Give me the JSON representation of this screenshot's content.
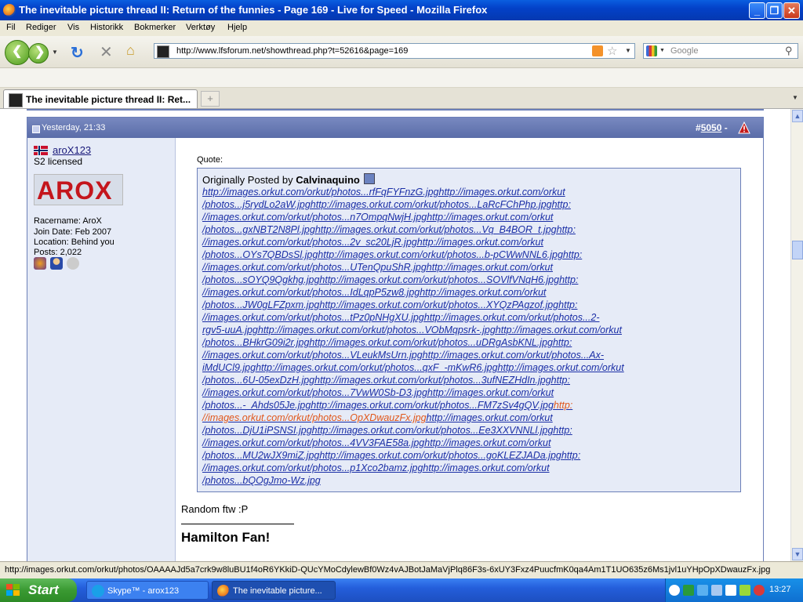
{
  "window": {
    "title": "The inevitable picture thread II: Return of the funnies - Page 169 - Live for Speed - Mozilla Firefox"
  },
  "menu": [
    "Fil",
    "Rediger",
    "Vis",
    "Historikk",
    "Bokmerker",
    "Verktøy",
    "Hjelp"
  ],
  "nav": {
    "url": "http://www.lfsforum.net/showthread.php?t=52616&page=169",
    "search_placeholder": "Google"
  },
  "tab": {
    "label": "The inevitable picture thread II: Ret..."
  },
  "post": {
    "date": "Yesterday, 21:33",
    "number_prefix": "#",
    "number": "5050",
    "number_suffix": "-",
    "user": {
      "name": "aroX123",
      "title": "S2 licensed",
      "avatar_text": "AROX",
      "racername": "Racername: AroX",
      "join_date": "Join Date: Feb 2007",
      "location": "Location: Behind you",
      "posts": "Posts: 2,022"
    },
    "quote_label": "Quote:",
    "quote_by_prefix": "Originally Posted by",
    "quote_author": "Calvinaquino",
    "quote_lines": [
      "http://images.orkut.com/orkut/photos...rfFqFYFnzG.jpghttp://images.orkut.com/orkut",
      "/photos...j5rydLo2aW.jpghttp://images.orkut.com/orkut/photos...LaRcFChPhp.jpghttp:",
      "//images.orkut.com/orkut/photos...n7OmpqNwjH.jpghttp://images.orkut.com/orkut",
      "/photos...gxNBT2N8Pl.jpghttp://images.orkut.com/orkut/photos...Vq_B4BOR_t.jpghttp:",
      "//images.orkut.com/orkut/photos...2v_sc20LjR.jpghttp://images.orkut.com/orkut",
      "/photos...OYs7QBDsSl.jpghttp://images.orkut.com/orkut/photos...b-pCWwNNL6.jpghttp:",
      "//images.orkut.com/orkut/photos...UTenQpuShR.jpghttp://images.orkut.com/orkut",
      "/photos...sOYQ9Qgkhg.jpghttp://images.orkut.com/orkut/photos...SOVlfVNqH6.jpghttp:",
      "//images.orkut.com/orkut/photos...IdLqpP5zw8.jpghttp://images.orkut.com/orkut",
      "/photos...JW0gLFZpxm.jpghttp://images.orkut.com/orkut/photos...XYQzPAgzof.jpghttp:",
      "//images.orkut.com/orkut/photos...tPz0pNHgXU.jpghttp://images.orkut.com/orkut/photos...2-",
      "rgv5-uuA.jpghttp://images.orkut.com/orkut/photos...VObMqpsrk-.jpghttp://images.orkut.com/orkut",
      "/photos...BHkrG09i2r.jpghttp://images.orkut.com/orkut/photos...uDRgAsbKNL.jpghttp:",
      "//images.orkut.com/orkut/photos...VLeukMsUrn.jpghttp://images.orkut.com/orkut/photos...Ax-",
      "iMdUCl9.jpghttp://images.orkut.com/orkut/photos...qxF_-mKwR6.jpghttp://images.orkut.com/orkut",
      "/photos...6U-05exDzH.jpghttp://images.orkut.com/orkut/photos...3ufNEZHdIn.jpghttp:",
      "//images.orkut.com/orkut/photos...7VwW0Sb-D3.jpghttp://images.orkut.com/orkut",
      "/photos...-_Ahds05Je.jpghttp://images.orkut.com/orkut/photos...FM7zSv4gQV.jpg",
      "//images.orkut.com/orkut/photos...OpXDwauzFx.jpg",
      "/photos...DjU1iPSNSI.jpghttp://images.orkut.com/orkut/photos...Ee3XXVNNLl.jpghttp:",
      "//images.orkut.com/orkut/photos...4VV3FAE58a.jpghttp://images.orkut.com/orkut",
      "/photos...MU2wJX9miZ.jpghttp://images.orkut.com/orkut/photos...goKLEZJADa.jpghttp:",
      "//images.orkut.com/orkut/photos...p1Xco2bamz.jpghttp://images.orkut.com/orkut",
      "/photos...bQOgJmo-Wz.jpg"
    ],
    "hover_part1": "http:",
    "hover_rest": "http://images.orkut.com/orkut",
    "body_text": "Random ftw :P",
    "signature": "Hamilton Fan!"
  },
  "status_text": "http://images.orkut.com/orkut/photos/OAAAAJd5a7crk9w8luBU1f4oR6YKkiD-QUcYMoCdylewBf0Wz4vAJBotJaMaVjPlq86F3s-6xUY3Fxz4PuucfmK0qa4Am1T1UO635z6Ms1jvl1uYHpOpXDwauzFx.jpg",
  "taskbar": {
    "start": "Start",
    "items": [
      "Skype™ - arox123",
      "The inevitable picture..."
    ],
    "clock": "13:27"
  }
}
